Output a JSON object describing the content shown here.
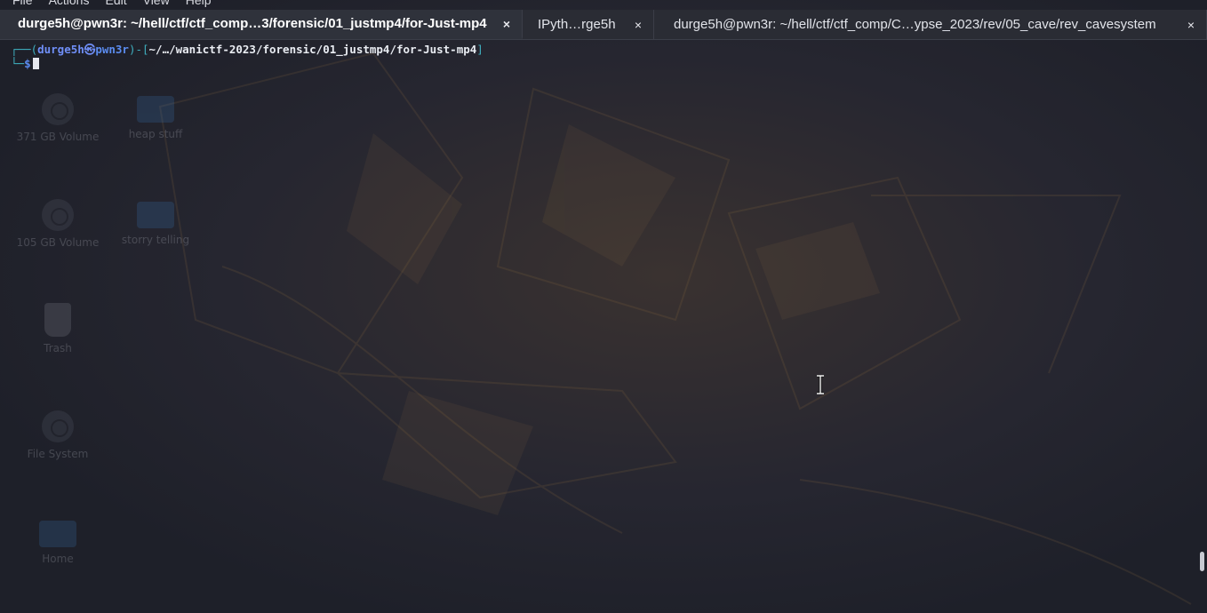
{
  "menubar": {
    "items": [
      "File",
      "Actions",
      "Edit",
      "View",
      "Help"
    ]
  },
  "tabs": [
    {
      "label": "durge5h@pwn3r: ~/hell/ctf/ctf_comp…3/forensic/01_justmp4/for-Just-mp4",
      "close": "×",
      "active": true
    },
    {
      "label": "IPyth…rge5h",
      "close": "×",
      "active": false
    },
    {
      "label": "durge5h@pwn3r: ~/hell/ctf/ctf_comp/C…ypse_2023/rev/05_cave/rev_cavesystem",
      "close": "×",
      "active": false
    }
  ],
  "prompt": {
    "corner_top": "┌──(",
    "user": "durge5h",
    "separator": "㉿",
    "host": "pwn3r",
    "mid": ")-[",
    "path": "~/…/wanictf-2023/forensic/01_justmp4/for-Just-mp4",
    "close": "]",
    "corner_bottom": "└─",
    "dollar": "$"
  },
  "desktop": {
    "icons": [
      {
        "label": "371 GB Volume",
        "icon": "disk-icon"
      },
      {
        "label": "heap stuff",
        "icon": "folder-icon"
      },
      {
        "label": "105 GB Volume",
        "icon": "disk-icon"
      },
      {
        "label": "storry telling",
        "icon": "folder-icon"
      },
      {
        "label": "Trash",
        "icon": "trash-icon"
      },
      {
        "label": "File System",
        "icon": "disk-icon"
      },
      {
        "label": "Home",
        "icon": "home-folder-icon"
      }
    ]
  },
  "colors": {
    "background": "#1f2129",
    "tabbar": "#2a2c34",
    "prompt_frame": "#3fb0c0",
    "prompt_user": "#6f8ef6",
    "prompt_path": "#e9ecf2"
  }
}
